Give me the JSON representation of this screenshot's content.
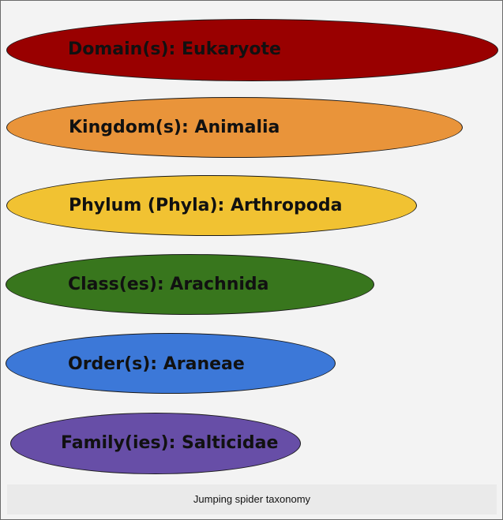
{
  "taxonomy_levels": [
    {
      "label": "Domain(s): Eukaryote",
      "color": "#990000"
    },
    {
      "label": "Kingdom(s): Animalia",
      "color": "#e9943a"
    },
    {
      "label": "Phylum (Phyla): Arthropoda",
      "color": "#f1c232"
    },
    {
      "label": "Class(es): Arachnida",
      "color": "#38761d"
    },
    {
      "label": "Order(s): Araneae",
      "color": "#3c78d8"
    },
    {
      "label": "Family(ies): Salticidae",
      "color": "#674ea7"
    }
  ],
  "caption": "Jumping spider taxonomy"
}
